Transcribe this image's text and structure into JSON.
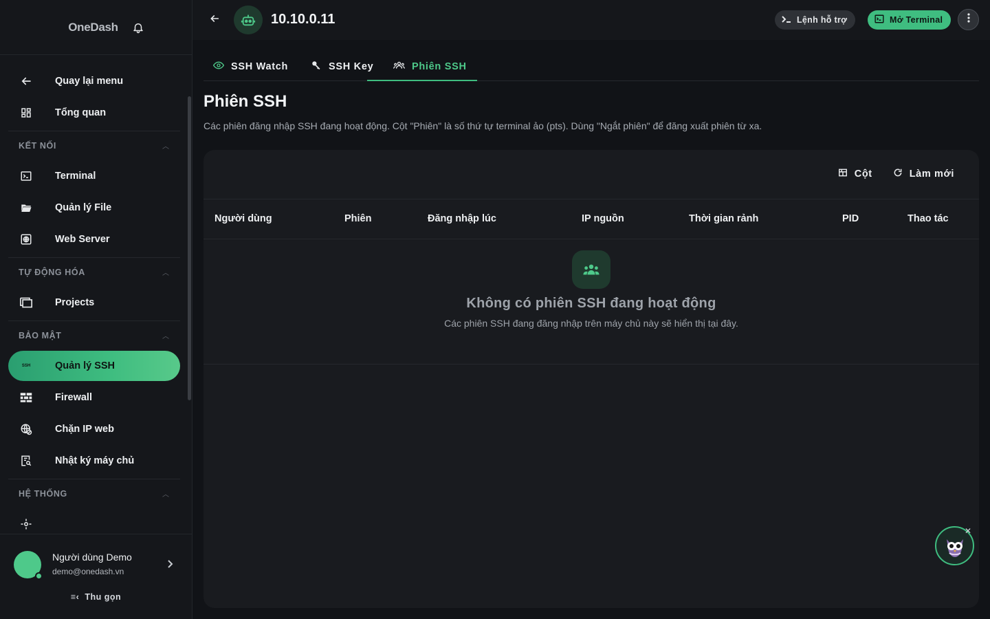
{
  "sidebar": {
    "brand": "OneDash",
    "items_top": [
      {
        "label": "Quay lại menu",
        "icon": "arrow-left-icon"
      },
      {
        "label": "Tổng quan",
        "icon": "dashboard-icon"
      }
    ],
    "sections": [
      {
        "title": "KẾT NỐI",
        "items": [
          {
            "label": "Terminal",
            "icon": "terminal-icon"
          },
          {
            "label": "Quản lý File",
            "icon": "folder-icon"
          },
          {
            "label": "Web Server",
            "icon": "web-server-icon"
          }
        ]
      },
      {
        "title": "TỰ ĐỘNG HÓA",
        "items": [
          {
            "label": "Projects",
            "icon": "projects-icon"
          }
        ]
      },
      {
        "title": "BẢO MẬT",
        "items": [
          {
            "label": "Quản lý SSH",
            "icon": "ssh-icon",
            "active": true,
            "icon_text": "SSH"
          },
          {
            "label": "Firewall",
            "icon": "firewall-icon"
          },
          {
            "label": "Chặn IP web",
            "icon": "globe-block-icon"
          },
          {
            "label": "Nhật ký máy chủ",
            "icon": "log-search-icon"
          }
        ]
      },
      {
        "title": "HỆ THỐNG",
        "items": []
      }
    ],
    "user": {
      "name": "Người dùng Demo",
      "email": "demo@onedash.vn"
    },
    "collapse_label": "Thu gọn"
  },
  "topbar": {
    "server_name": "10.10.0.11",
    "help_label": "Lệnh hỗ trợ",
    "terminal_label": "Mở Terminal"
  },
  "tabs": [
    {
      "label": "SSH Watch",
      "icon": "eye-icon"
    },
    {
      "label": "SSH Key",
      "icon": "key-icon"
    },
    {
      "label": "Phiên SSH",
      "icon": "users-icon",
      "active": true
    }
  ],
  "page": {
    "title": "Phiên SSH",
    "description": "Các phiên đăng nhập SSH đang hoạt động. Cột \"Phiên\" là số thứ tự terminal ảo (pts). Dùng \"Ngắt phiên\" để đăng xuất phiên từ xa."
  },
  "table": {
    "tools": {
      "columns_label": "Cột",
      "refresh_label": "Làm mới"
    },
    "columns": [
      "Người dùng",
      "Phiên",
      "Đăng nhập lúc",
      "IP nguồn",
      "Thời gian rảnh",
      "PID",
      "Thao tác"
    ],
    "empty_title": "Không có phiên SSH đang hoạt động",
    "empty_subtitle": "Các phiên SSH đang đăng nhập trên máy chủ này sẽ hiển thị tại đây."
  },
  "colors": {
    "accent": "#3fbd80",
    "background": "#111317",
    "panel": "#15171b",
    "card": "#191b1f"
  }
}
